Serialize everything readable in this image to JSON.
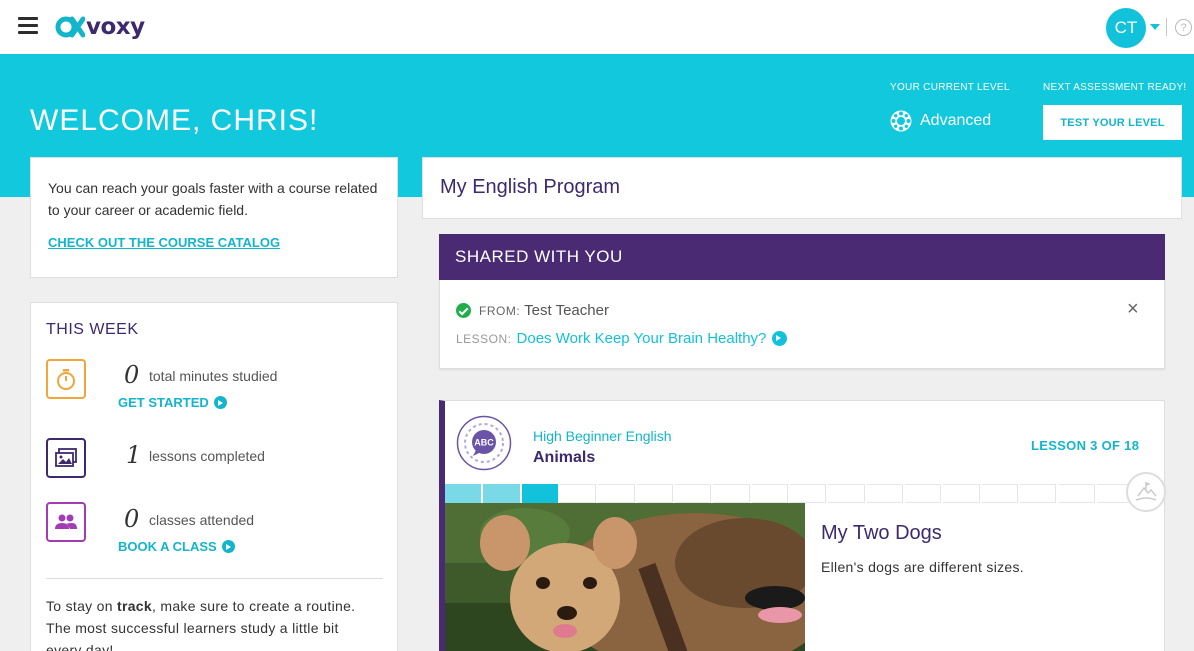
{
  "topbar": {
    "logo_text": "voxy",
    "avatar_initials": "CT",
    "help_glyph": "?",
    "icons": [
      "menu-icon",
      "chevron-down-icon",
      "help-icon"
    ]
  },
  "hero": {
    "welcome": "WELCOME, CHRIS!",
    "current_level_label": "YOUR CURRENT LEVEL",
    "current_level_value": "Advanced",
    "next_assessment_label": "NEXT ASSESSMENT READY!",
    "test_button": "TEST YOUR LEVEL"
  },
  "goal_card": {
    "text": "You can reach your goals faster with a course related to your career or academic field.",
    "link": "CHECK OUT THE COURSE CATALOG"
  },
  "this_week": {
    "title": "THIS WEEK",
    "stats": [
      {
        "value": "0",
        "label": "total minutes studied",
        "link": "GET STARTED",
        "icon": "stopwatch-icon"
      },
      {
        "value": "1",
        "label": "lessons completed",
        "icon": "picture-icon"
      },
      {
        "value": "0",
        "label": "classes attended",
        "link": "BOOK A CLASS",
        "icon": "people-icon"
      }
    ],
    "track_pre": "To stay on ",
    "track_bold": "track",
    "track_post": ", make sure to create a routine. The most successful learners study a little bit every day!"
  },
  "program": {
    "title": "My English Program"
  },
  "shared": {
    "header": "SHARED WITH YOU",
    "from_label": "FROM:",
    "from_name": "Test Teacher",
    "lesson_label": "LESSON:",
    "lesson_title": "Does Work Keep Your Brain Healthy?",
    "close": "×"
  },
  "course": {
    "level": "High Beginner English",
    "name": "Animals",
    "lesson_count": "LESSON 3 OF 18",
    "progress": {
      "completed": 2,
      "current": 3,
      "total": 18
    },
    "lesson_title": "My Two Dogs",
    "lesson_desc": "Ellen's dogs are different sizes.",
    "abc_text": "ABC"
  },
  "colors": {
    "brand_cyan": "#12c8dd",
    "brand_purple": "#4a2a73",
    "link": "#12b5cc",
    "stopwatch": "#f2a53a",
    "picture": "#3d2a6e",
    "people": "#a33bb5",
    "check": "#1fae4b"
  }
}
